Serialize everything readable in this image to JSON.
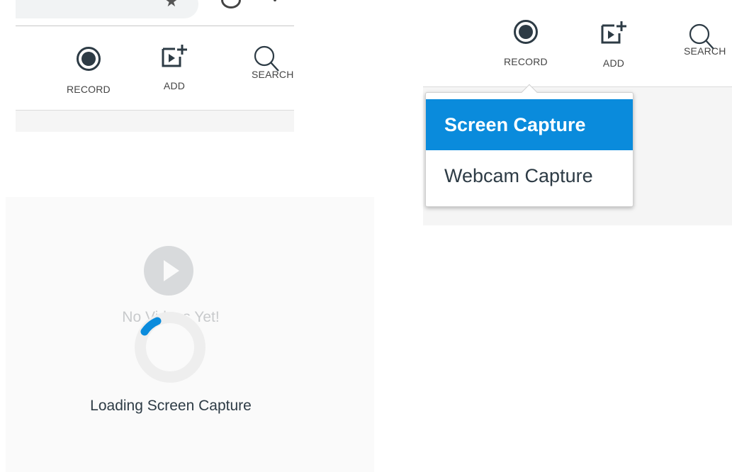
{
  "colors": {
    "accent": "#0a8bdc",
    "icon_dark": "#2d3b45",
    "muted": "#c8cacc"
  },
  "toolbar_crop": {
    "browser": {
      "icons": [
        "star-icon",
        "profile-icon",
        "kebab-menu-icon"
      ]
    },
    "buttons": [
      {
        "icon": "record-icon",
        "label": "RECORD"
      },
      {
        "icon": "add-media-icon",
        "label": "ADD"
      },
      {
        "icon": "search-icon",
        "label": "SEARCH"
      }
    ]
  },
  "dropdown_crop": {
    "buttons": [
      {
        "icon": "record-icon",
        "label": "RECORD"
      },
      {
        "icon": "add-media-icon",
        "label": "ADD"
      },
      {
        "icon": "search-icon",
        "label": "SEARCH"
      }
    ],
    "menu": [
      {
        "label": "Screen Capture",
        "active": true
      },
      {
        "label": "Webcam Capture",
        "active": false
      }
    ]
  },
  "loading_crop": {
    "empty_message": "No Videos Yet!",
    "loading_message": "Loading Screen Capture"
  }
}
